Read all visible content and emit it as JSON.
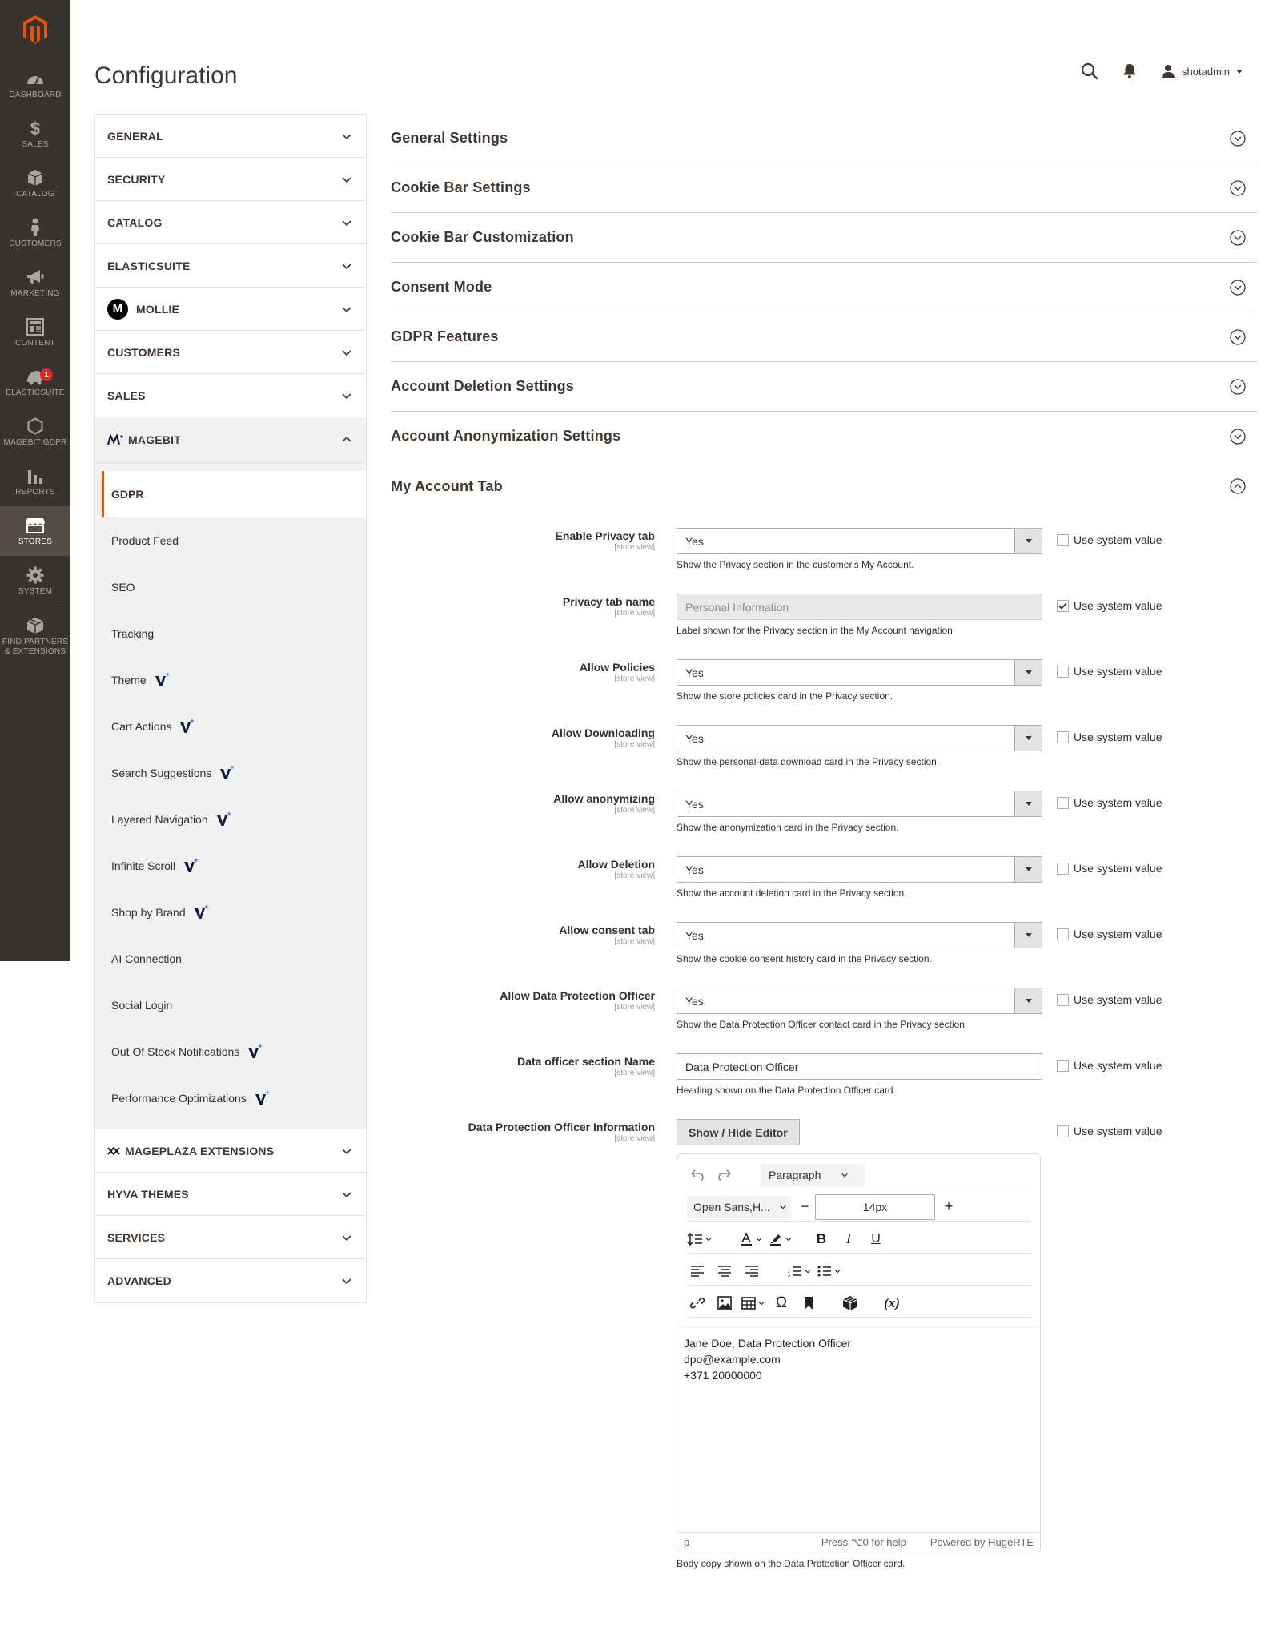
{
  "menu": {
    "items": [
      {
        "label": "DASHBOARD",
        "icon": "dashboard-icon"
      },
      {
        "label": "SALES",
        "icon": "dollar-icon"
      },
      {
        "label": "CATALOG",
        "icon": "cube-icon"
      },
      {
        "label": "CUSTOMERS",
        "icon": "person-icon"
      },
      {
        "label": "MARKETING",
        "icon": "megaphone-icon"
      },
      {
        "label": "CONTENT",
        "icon": "content-icon"
      },
      {
        "label": "ELASTICSUITE",
        "icon": "elasticsuite-icon",
        "badge": "1"
      },
      {
        "label": "MAGEBIT GDPR",
        "icon": "hexagon-icon"
      },
      {
        "label": "REPORTS",
        "icon": "bar-chart-icon"
      },
      {
        "label": "STORES",
        "icon": "store-icon",
        "active": true
      },
      {
        "label": "SYSTEM",
        "icon": "gear-icon"
      },
      {
        "label": "FIND PARTNERS & EXTENSIONS",
        "icon": "box-icon"
      }
    ],
    "active_color": "#524d49",
    "bg_color": "#373330"
  },
  "header": {
    "title": "Configuration",
    "user_name": "shotadmin",
    "search_icon": "search-icon",
    "bell_icon": "bell-icon"
  },
  "tabs": {
    "groups_top": [
      "GENERAL",
      "SECURITY",
      "CATALOG",
      "ELASTICSUITE",
      "MOLLIE",
      "CUSTOMERS",
      "SALES"
    ],
    "open_group": "MAGEBIT",
    "mollie_letter": "m",
    "sub_items": [
      {
        "label": "GDPR",
        "active": true,
        "v": false
      },
      {
        "label": "Product Feed",
        "v": false
      },
      {
        "label": "SEO",
        "v": false
      },
      {
        "label": "Tracking",
        "v": false
      },
      {
        "label": "Theme",
        "v": true
      },
      {
        "label": "Cart Actions",
        "v": true
      },
      {
        "label": "Search Suggestions",
        "v": true
      },
      {
        "label": "Layered Navigation",
        "v": true
      },
      {
        "label": "Infinite Scroll",
        "v": true
      },
      {
        "label": "Shop by Brand",
        "v": true
      },
      {
        "label": "AI Connection",
        "v": false
      },
      {
        "label": "Social Login",
        "v": false
      },
      {
        "label": "Out Of Stock Notifications",
        "v": true
      },
      {
        "label": "Performance Optimizations",
        "v": true
      }
    ],
    "groups_bottom": [
      "MAGEPLAZA EXTENSIONS",
      "HYVA THEMES",
      "SERVICES",
      "ADVANCED"
    ],
    "accent_color": "#eb5202"
  },
  "sections": [
    "General Settings",
    "Cookie Bar Settings",
    "Cookie Bar Customization",
    "Consent Mode",
    "GDPR Features",
    "Account Deletion Settings",
    "Account Anonymization Settings",
    "My Account Tab"
  ],
  "open_section": "My Account Tab",
  "scope_label": "[store view]",
  "system_value_label": "Use system value",
  "fields": [
    {
      "label": "Enable Privacy tab",
      "type": "select",
      "value": "Yes",
      "note": "Show the Privacy section in the customer's My Account.",
      "use_system": false
    },
    {
      "label": "Privacy tab name",
      "type": "input-disabled",
      "value": "Personal Information",
      "note": "Label shown for the Privacy section in the My Account navigation.",
      "use_system": true
    },
    {
      "label": "Allow Policies",
      "type": "select",
      "value": "Yes",
      "note": "Show the store policies card in the Privacy section.",
      "use_system": false
    },
    {
      "label": "Allow Downloading",
      "type": "select",
      "value": "Yes",
      "note": "Show the personal-data download card in the Privacy section.",
      "use_system": false
    },
    {
      "label": "Allow anonymizing",
      "type": "select",
      "value": "Yes",
      "note": "Show the anonymization card in the Privacy section.",
      "use_system": false
    },
    {
      "label": "Allow Deletion",
      "type": "select",
      "value": "Yes",
      "note": "Show the account deletion card in the Privacy section.",
      "use_system": false
    },
    {
      "label": "Allow consent tab",
      "type": "select",
      "value": "Yes",
      "note": "Show the cookie consent history card in the Privacy section.",
      "use_system": false
    },
    {
      "label": "Allow Data Protection Officer",
      "type": "select",
      "value": "Yes",
      "note": "Show the Data Protection Officer contact card in the Privacy section.",
      "use_system": false
    },
    {
      "label": "Data officer section Name",
      "type": "input",
      "value": "Data Protection Officer",
      "note": "Heading shown on the Data Protection Officer card.",
      "use_system": false
    },
    {
      "label": "Data Protection Officer Information",
      "type": "editor",
      "value": "",
      "note": "",
      "use_system": false
    }
  ],
  "editor": {
    "toggle_button": "Show / Hide Editor",
    "block_format": "Paragraph",
    "font_family": "Open Sans,H...",
    "font_size": "14px",
    "content_lines": [
      "Jane Doe, Data Protection Officer",
      "dpo@example.com",
      "+371 20000000"
    ],
    "status_path": "p",
    "status_help": "Press ⌥0 for help",
    "status_powered": "Powered by HugeRTE",
    "note": "Body copy shown on the Data Protection Officer card."
  }
}
